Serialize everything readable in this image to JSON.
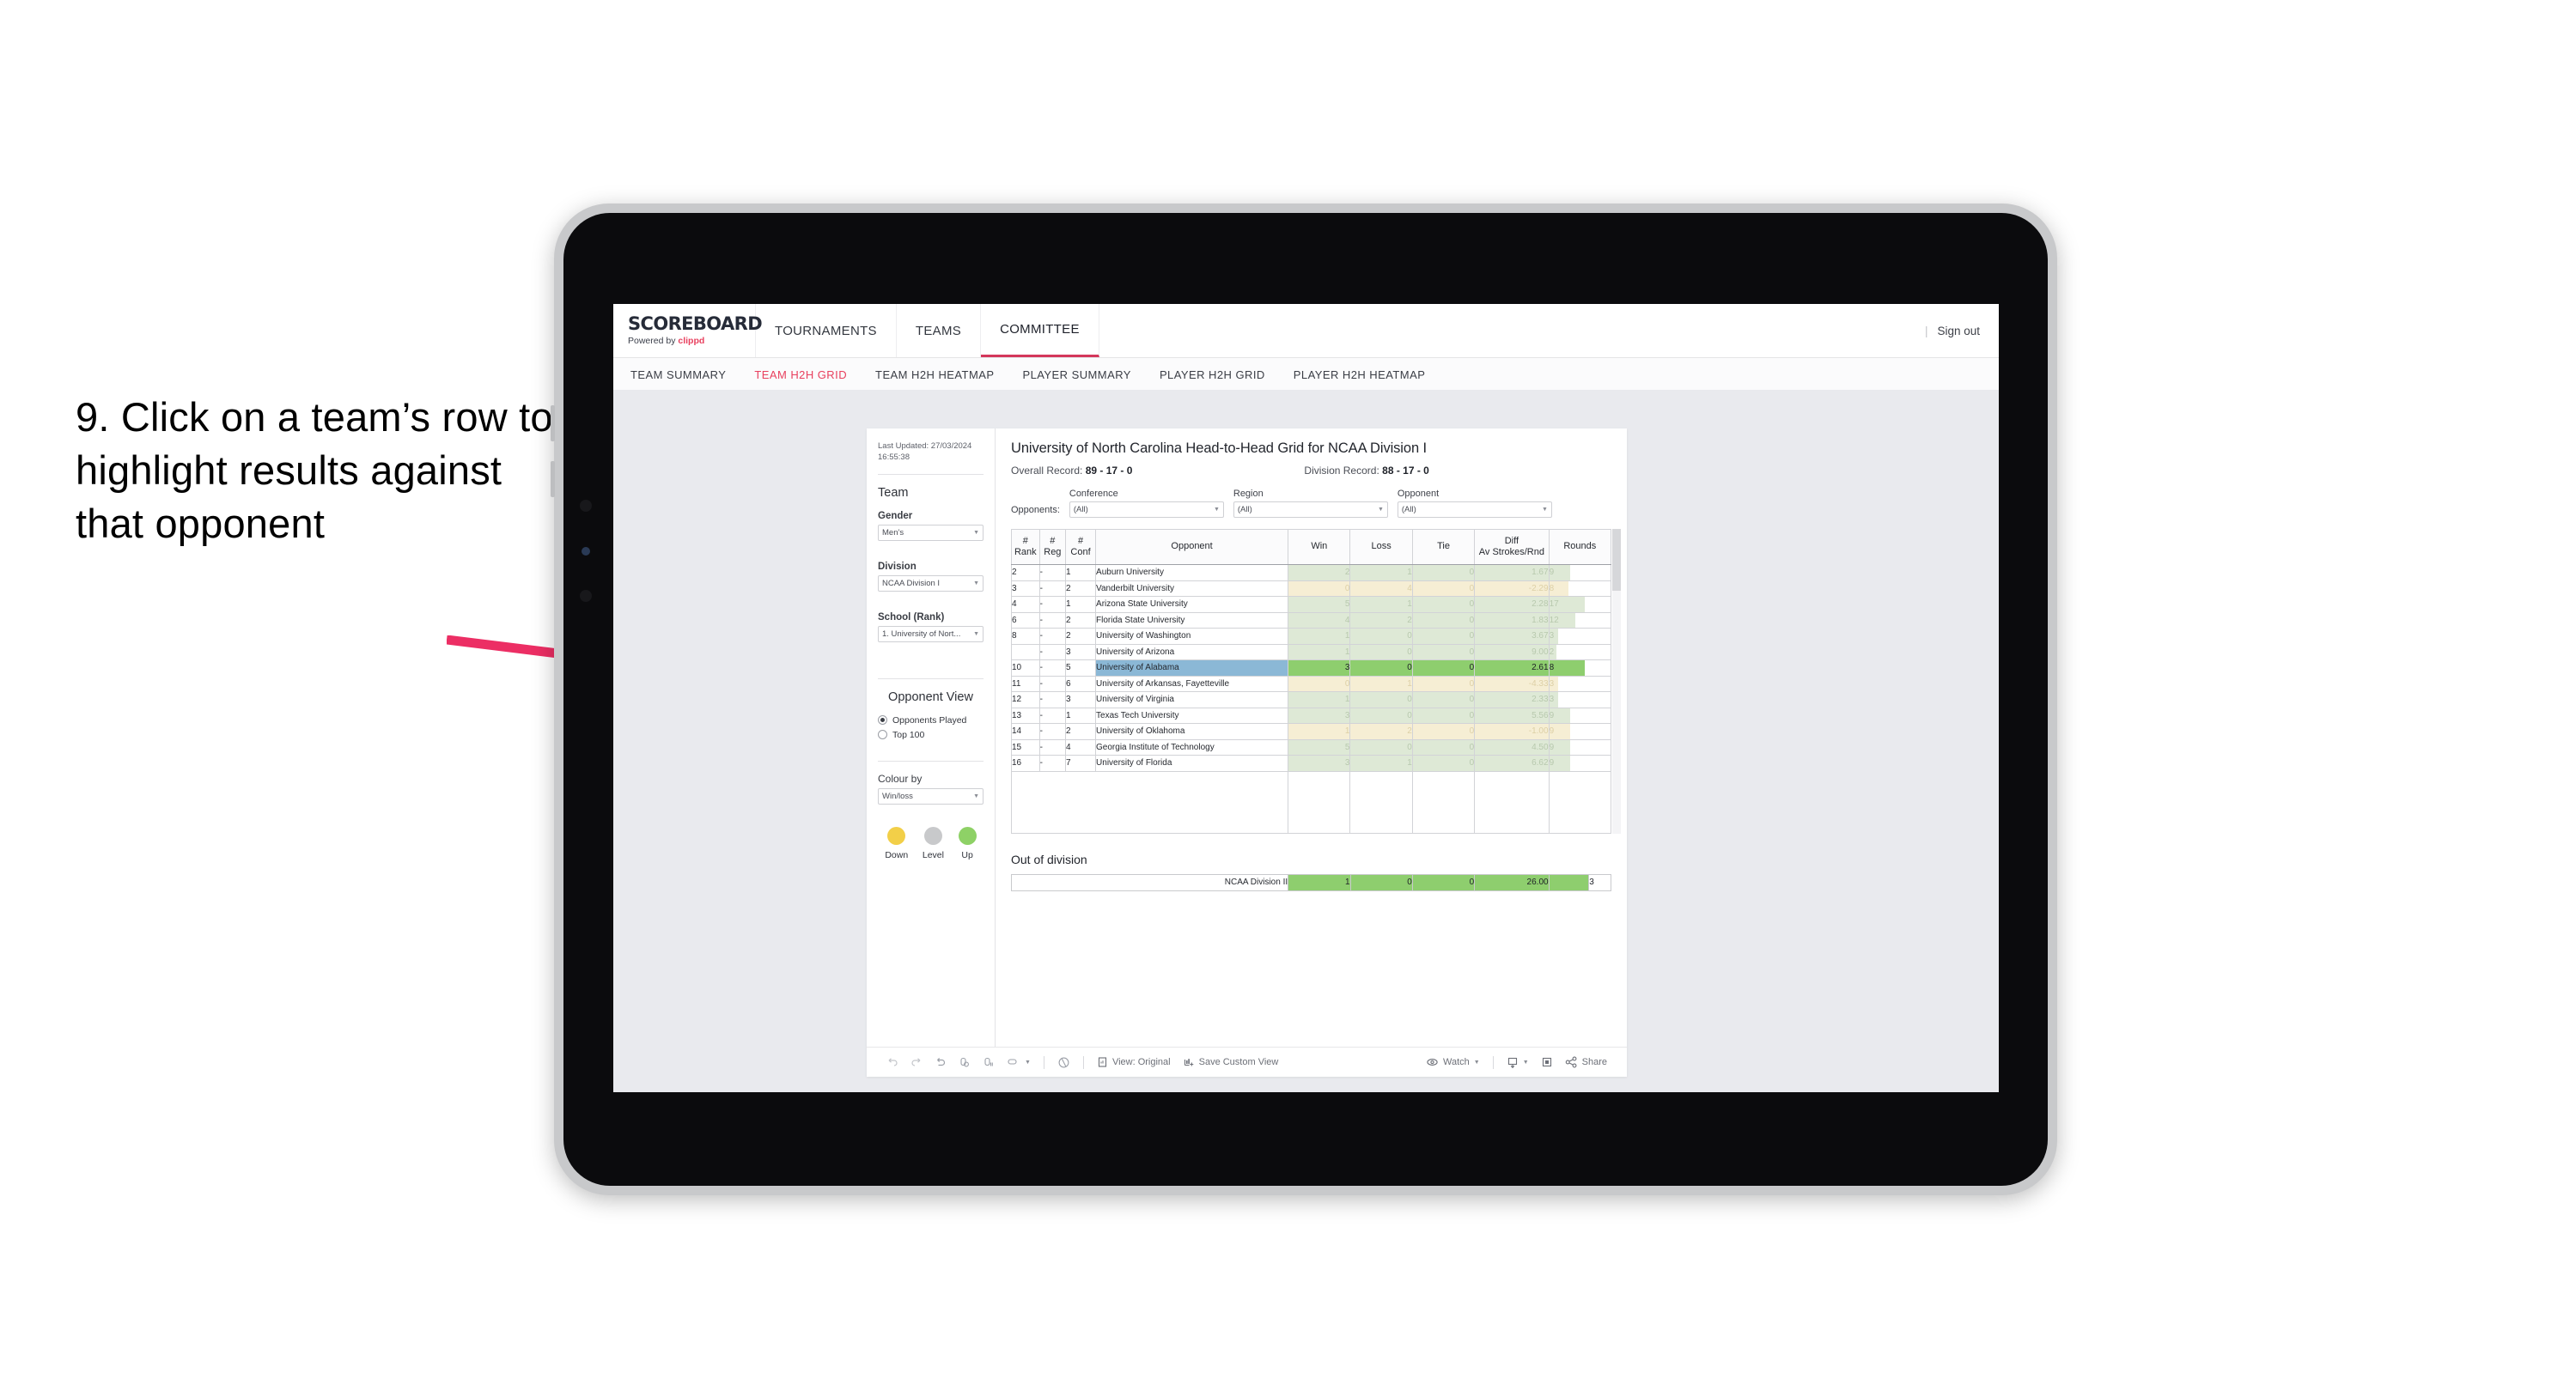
{
  "annotation": {
    "text": "9. Click on a team’s row to highlight results against that opponent",
    "arrow_color": "#ec2e64"
  },
  "app": {
    "brand": {
      "name": "SCOREBOARD",
      "powered_prefix": "Powered by ",
      "powered_brand": "clippd"
    },
    "top_nav": [
      {
        "label": "TOURNAMENTS",
        "active": false
      },
      {
        "label": "TEAMS",
        "active": false
      },
      {
        "label": "COMMITTEE",
        "active": true
      }
    ],
    "sign_out": "Sign out",
    "sub_nav": [
      {
        "label": "TEAM SUMMARY",
        "active": false
      },
      {
        "label": "TEAM H2H GRID",
        "active": true
      },
      {
        "label": "TEAM H2H HEATMAP",
        "active": false
      },
      {
        "label": "PLAYER SUMMARY",
        "active": false
      },
      {
        "label": "PLAYER H2H GRID",
        "active": false
      },
      {
        "label": "PLAYER H2H HEATMAP",
        "active": false
      }
    ]
  },
  "sidebar": {
    "last_updated": "Last Updated: 27/03/2024 16:55:38",
    "team_heading": "Team",
    "gender_label": "Gender",
    "gender_value": "Men’s",
    "division_label": "Division",
    "division_value": "NCAA Division I",
    "school_label": "School (Rank)",
    "school_value": "1. University of Nort...",
    "opponent_view_heading": "Opponent View",
    "opponent_view_options": [
      {
        "label": "Opponents Played",
        "selected": true
      },
      {
        "label": "Top 100",
        "selected": false
      }
    ],
    "colour_by_label": "Colour by",
    "colour_by_value": "Win/loss",
    "legend": [
      {
        "label": "Down",
        "color": "#f2cf48"
      },
      {
        "label": "Level",
        "color": "#c8c9cb"
      },
      {
        "label": "Up",
        "color": "#8ed166"
      }
    ]
  },
  "main": {
    "title": "University of North Carolina Head-to-Head Grid for NCAA Division I",
    "overall_record_label": "Overall Record:",
    "overall_record_value": "89 - 17 - 0",
    "division_record_label": "Division Record:",
    "division_record_value": "88 - 17 - 0",
    "opponents_label": "Opponents:",
    "filters": [
      {
        "label": "Conference",
        "value": "(All)"
      },
      {
        "label": "Region",
        "value": "(All)"
      },
      {
        "label": "Opponent",
        "value": "(All)"
      }
    ]
  },
  "chart_data": {
    "type": "table",
    "title": "University of North Carolina Head-to-Head Grid for NCAA Division I",
    "columns": [
      "# Rank",
      "# Reg",
      "# Conf",
      "Opponent",
      "Win",
      "Loss",
      "Tie",
      "Diff Av Strokes/Rnd",
      "Rounds"
    ],
    "rows": [
      {
        "rank": "2",
        "reg": "-",
        "conf": "1",
        "opponent": "Auburn University",
        "win": "2",
        "loss": "1",
        "tie": "0",
        "diff": "1.67",
        "rounds": "9",
        "result": "up",
        "selected": false
      },
      {
        "rank": "3",
        "reg": "-",
        "conf": "2",
        "opponent": "Vanderbilt University",
        "win": "0",
        "loss": "4",
        "tie": "0",
        "diff": "-2.29",
        "rounds": "8",
        "result": "down",
        "selected": false
      },
      {
        "rank": "4",
        "reg": "-",
        "conf": "1",
        "opponent": "Arizona State University",
        "win": "5",
        "loss": "1",
        "tie": "0",
        "diff": "2.28",
        "rounds": "17",
        "result": "up",
        "selected": false
      },
      {
        "rank": "6",
        "reg": "-",
        "conf": "2",
        "opponent": "Florida State University",
        "win": "4",
        "loss": "2",
        "tie": "0",
        "diff": "1.83",
        "rounds": "12",
        "result": "up",
        "selected": false
      },
      {
        "rank": "8",
        "reg": "-",
        "conf": "2",
        "opponent": "University of Washington",
        "win": "1",
        "loss": "0",
        "tie": "0",
        "diff": "3.67",
        "rounds": "3",
        "result": "up",
        "selected": false
      },
      {
        "rank": "",
        "reg": "-",
        "conf": "3",
        "opponent": "University of Arizona",
        "win": "1",
        "loss": "0",
        "tie": "0",
        "diff": "9.00",
        "rounds": "2",
        "result": "up",
        "selected": false
      },
      {
        "rank": "10",
        "reg": "-",
        "conf": "5",
        "opponent": "University of Alabama",
        "win": "3",
        "loss": "0",
        "tie": "0",
        "diff": "2.61",
        "rounds": "8",
        "result": "up",
        "selected": true
      },
      {
        "rank": "11",
        "reg": "-",
        "conf": "6",
        "opponent": "University of Arkansas, Fayetteville",
        "win": "0",
        "loss": "1",
        "tie": "0",
        "diff": "-4.33",
        "rounds": "3",
        "result": "down",
        "selected": false
      },
      {
        "rank": "12",
        "reg": "-",
        "conf": "3",
        "opponent": "University of Virginia",
        "win": "1",
        "loss": "0",
        "tie": "0",
        "diff": "2.33",
        "rounds": "3",
        "result": "up",
        "selected": false
      },
      {
        "rank": "13",
        "reg": "-",
        "conf": "1",
        "opponent": "Texas Tech University",
        "win": "3",
        "loss": "0",
        "tie": "0",
        "diff": "5.56",
        "rounds": "9",
        "result": "up",
        "selected": false
      },
      {
        "rank": "14",
        "reg": "-",
        "conf": "2",
        "opponent": "University of Oklahoma",
        "win": "1",
        "loss": "2",
        "tie": "0",
        "diff": "-1.00",
        "rounds": "9",
        "result": "down",
        "selected": false
      },
      {
        "rank": "15",
        "reg": "-",
        "conf": "4",
        "opponent": "Georgia Institute of Technology",
        "win": "5",
        "loss": "0",
        "tie": "0",
        "diff": "4.50",
        "rounds": "9",
        "result": "up",
        "selected": false
      },
      {
        "rank": "16",
        "reg": "-",
        "conf": "7",
        "opponent": "University of Florida",
        "win": "3",
        "loss": "1",
        "tie": "0",
        "diff": "6.62",
        "rounds": "9",
        "result": "up",
        "selected": false
      }
    ],
    "out_of_division": {
      "heading": "Out of division",
      "rows": [
        {
          "label": "NCAA Division II",
          "win": "1",
          "loss": "0",
          "tie": "0",
          "diff": "26.00",
          "rounds": "3"
        }
      ]
    },
    "colors": {
      "up": "#dee9d6",
      "down": "#f6eed4",
      "selected_row_bg": "#8bb8d6",
      "selected_up": "#8ece6e"
    }
  },
  "toolbar": {
    "view_label": "View: Original",
    "save_label": "Save Custom View",
    "watch_label": "Watch",
    "share_label": "Share"
  }
}
